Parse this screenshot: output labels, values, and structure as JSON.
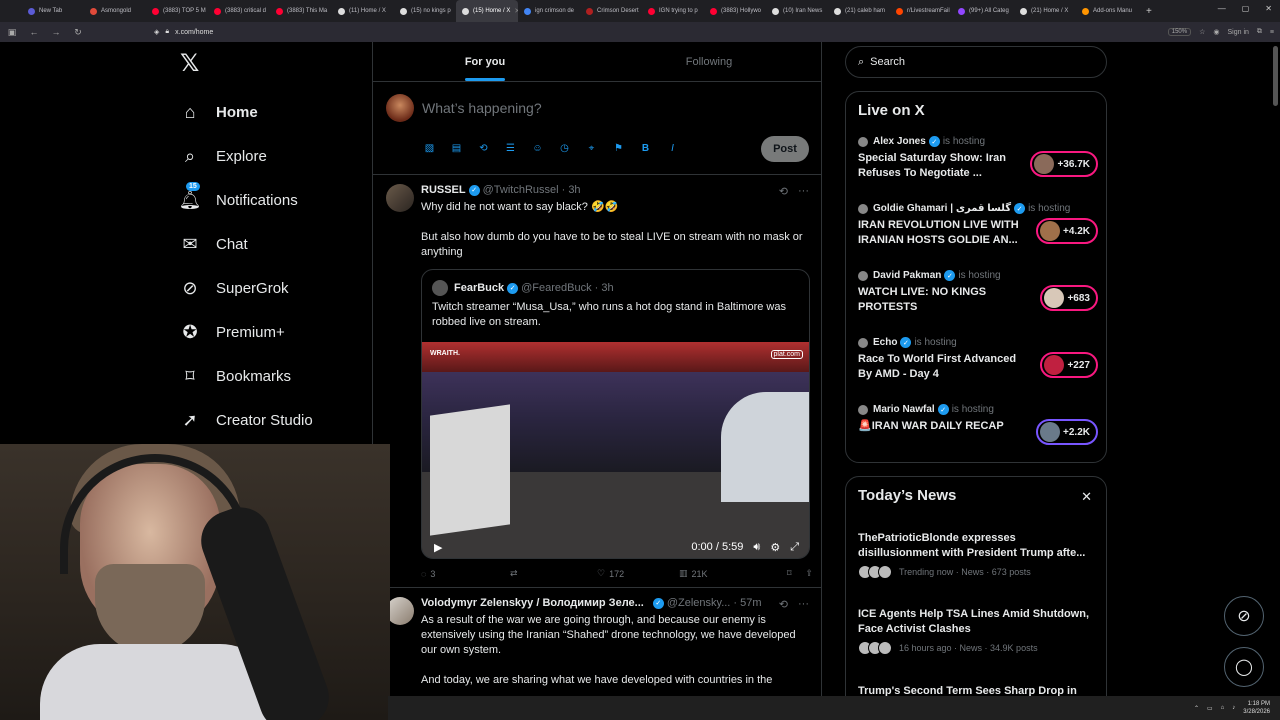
{
  "browser": {
    "tabs": [
      {
        "label": "New Tab",
        "color": "#5b5bd6"
      },
      {
        "label": "Asmongold",
        "color": "#e04a3a"
      },
      {
        "label": "(3883) TOP 5 M",
        "color": "#ff0033"
      },
      {
        "label": "(3883) critical d",
        "color": "#ff0033"
      },
      {
        "label": "(3883) This Ma",
        "color": "#ff0033"
      },
      {
        "label": "(11) Home / X",
        "color": "#dddddd"
      },
      {
        "label": "(15) no kings p",
        "color": "#dddddd"
      },
      {
        "label": "(15) Home / X",
        "color": "#dddddd"
      },
      {
        "label": "ign crimson de",
        "color": "#4285f4"
      },
      {
        "label": "Crimson Desert",
        "color": "#b02020"
      },
      {
        "label": "IGN trying to p",
        "color": "#ff0033"
      },
      {
        "label": "(3883) Hollywo",
        "color": "#ff0033"
      },
      {
        "label": "(10) Iran News",
        "color": "#dddddd"
      },
      {
        "label": "(21) caleb ham",
        "color": "#dddddd"
      },
      {
        "label": "r/LivestreamFail",
        "color": "#ff4500"
      },
      {
        "label": "(99+) All Categ",
        "color": "#9146ff"
      },
      {
        "label": "(21) Home / X",
        "color": "#dddddd"
      },
      {
        "label": "Add-ons Manu",
        "color": "#ff9500"
      }
    ],
    "url": "x.com/home",
    "zoom": "150%",
    "signin": "Sign in"
  },
  "nav": {
    "items": [
      {
        "label": "Home",
        "icon": "home-icon"
      },
      {
        "label": "Explore",
        "icon": "search-icon"
      },
      {
        "label": "Notifications",
        "icon": "bell-icon",
        "badge": "15"
      },
      {
        "label": "Chat",
        "icon": "mail-icon"
      },
      {
        "label": "SuperGrok",
        "icon": "grok-icon"
      },
      {
        "label": "Premium+",
        "icon": "premium-icon"
      },
      {
        "label": "Bookmarks",
        "icon": "bookmark-icon"
      },
      {
        "label": "Creator Studio",
        "icon": "rocket-icon"
      }
    ]
  },
  "feed": {
    "tabs": [
      "For you",
      "Following"
    ],
    "compose_placeholder": "What’s happening?",
    "post_label": "Post",
    "tweet1": {
      "name": "RUSSEL",
      "handle": "@TwitchRussel",
      "time": "· 3h",
      "text1": "Why did he not want to say black? 🤣🤣",
      "text2": "But also how dumb do you have to be to steal LIVE on stream with no mask or anything",
      "quote": {
        "name": "FearBuck",
        "handle": "@FearedBuck",
        "time": "· 3h",
        "text": "Twitch streamer “Musa_Usa,” who runs a hot dog stand in Baltimore was robbed live on stream.",
        "video_time": "0:00 / 5:59",
        "watermark": "WRAITH.",
        "watermark2": "plat.com"
      },
      "stats": {
        "replies": "3",
        "reposts": "",
        "likes": "172",
        "views": "21K"
      }
    },
    "tweet2": {
      "name": "Volodymyr Zelenskyy / Володимир Зеле...",
      "handle": "@Zelensky...",
      "time": "· 57m",
      "text1": "As a result of the war we are going through, and because our enemy is extensively using the Iranian “Shahed” drone technology, we have developed our own system.",
      "text2": "And today, we are sharing what we have developed with countries in the"
    }
  },
  "sidebar": {
    "search_placeholder": "Search",
    "live": {
      "title": "Live on X",
      "items": [
        {
          "host": "Alex Jones",
          "status": "is hosting",
          "title": "Special Saturday Show: Iran Refuses To Negotiate ...",
          "count": "+36.7K"
        },
        {
          "host": "Goldie Ghamari | گلسا قمری",
          "status": "is hosting",
          "title": "IRAN REVOLUTION LIVE WITH IRANIAN HOSTS GOLDIE AN...",
          "count": "+4.2K"
        },
        {
          "host": "David Pakman",
          "status": "is hosting",
          "title": "WATCH LIVE: NO KINGS PROTESTS",
          "count": "+683"
        },
        {
          "host": "Echo",
          "status": "is hosting",
          "title": "Race To World First Advanced By AMD - Day 4",
          "count": "+227"
        },
        {
          "host": "Mario Nawfal",
          "status": "is hosting",
          "title": "🚨IRAN WAR DAILY RECAP",
          "count": "+2.2K"
        }
      ]
    },
    "news": {
      "title": "Today’s News",
      "items": [
        {
          "title": "ThePatrioticBlonde expresses disillusionment with President Trump afte...",
          "meta": "Trending now · News · 673 posts"
        },
        {
          "title": "ICE Agents Help TSA Lines Amid Shutdown, Face Activist Clashes",
          "meta": "16 hours ago · News · 34.9K posts"
        },
        {
          "title": "Trump's Second Term Sees Sharp Drop in",
          "meta": ""
        }
      ]
    }
  },
  "taskbar": {
    "time": "1:18 PM",
    "date": "3/28/2026"
  },
  "colors": {
    "accent": "#1d9bf0",
    "live_pill": "#f91880",
    "live_pill_alt": "#7856ff"
  }
}
